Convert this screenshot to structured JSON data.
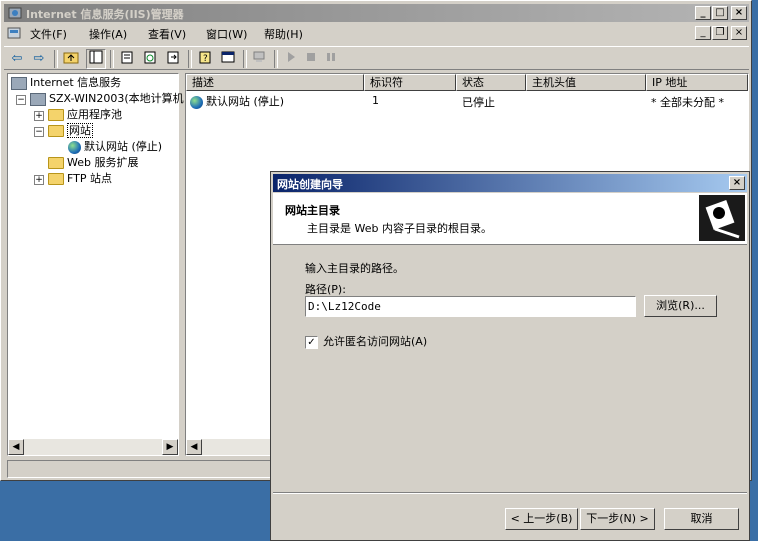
{
  "window": {
    "title": "Internet 信息服务(IIS)管理器",
    "min": "_",
    "max": "□",
    "close": "×"
  },
  "menu": {
    "items": [
      "文件(F)",
      "操作(A)",
      "查看(V)",
      "窗口(W)",
      "帮助(H)"
    ],
    "mdi_min": "_",
    "mdi_restore": "❐",
    "mdi_close": "×"
  },
  "toolbar": {
    "back": "⇦",
    "forward": "⇨"
  },
  "tree": {
    "root": "Internet 信息服务",
    "server": "SZX-WIN2003(本地计算机",
    "app_pools": "应用程序池",
    "websites": "网站",
    "default_site": "默认网站 (停止)",
    "web_ext": "Web 服务扩展",
    "ftp": "FTP 站点"
  },
  "list": {
    "columns": [
      "描述",
      "标识符",
      "状态",
      "主机头值",
      "IP 地址"
    ],
    "rows": [
      {
        "desc": "默认网站 (停止)",
        "id": "1",
        "status": "已停止",
        "host": "",
        "ip": "* 全部未分配 *"
      }
    ]
  },
  "dialog": {
    "title": "网站创建向导",
    "close": "×",
    "heading": "网站主目录",
    "subheading": "主目录是 Web 内容子目录的根目录。",
    "prompt": "输入主目录的路径。",
    "path_label": "路径(P):",
    "path_value": "D:\\Lz12Code",
    "browse": "浏览(R)...",
    "anon_checkbox": "允许匿名访问网站(A)",
    "anon_checked": true,
    "back": "< 上一步(B)",
    "next": "下一步(N) >",
    "cancel": "取消"
  }
}
